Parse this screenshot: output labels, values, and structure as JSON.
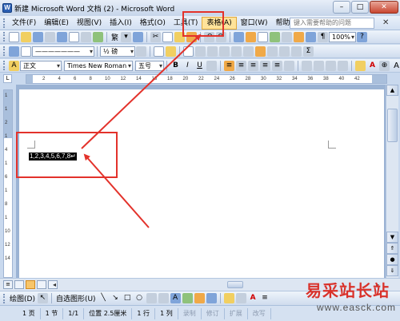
{
  "window": {
    "title": "新建 Microsoft Word 文档 (2) - Microsoft Word",
    "minimize": "–",
    "maximize": "□",
    "close": "✕"
  },
  "menubar": {
    "items": [
      {
        "label": "文件(F)"
      },
      {
        "label": "编辑(E)"
      },
      {
        "label": "视图(V)"
      },
      {
        "label": "插入(I)"
      },
      {
        "label": "格式(O)"
      },
      {
        "label": "工具(T)"
      },
      {
        "label": "表格(A)",
        "active": true
      },
      {
        "label": "窗口(W)"
      },
      {
        "label": "帮助(H)"
      }
    ],
    "help_placeholder": "键入需要帮助的问题",
    "doc_close": "✕"
  },
  "toolbar_standard": {
    "zoom": "100%",
    "script_label": "繁",
    "help_label": "?"
  },
  "toolbar_drawing_top": {
    "line_weight": "½ 磅",
    "line_style": "———————"
  },
  "toolbar_format": {
    "style": "正文",
    "font": "Times New Roman",
    "size": "五号",
    "bold": "B",
    "italic": "I",
    "underline": "U",
    "font_color_label": "A",
    "grow_font": "A",
    "shrink_font": "A"
  },
  "ruler": {
    "ticks": [
      "2",
      "4",
      "6",
      "8",
      "10",
      "12",
      "14",
      "16",
      "18",
      "20",
      "22",
      "24",
      "26",
      "28",
      "30",
      "32",
      "34",
      "36",
      "38",
      "40",
      "42"
    ],
    "vticks": [
      "1",
      "1",
      "2",
      "1",
      "4",
      "1",
      "6",
      "1",
      "8",
      "1",
      "10",
      "12",
      "14"
    ]
  },
  "document": {
    "selected_text": "1,2,3,4,5,6,7,8",
    "para_mark": "↵"
  },
  "drawbar": {
    "draw_label": "绘图(D)",
    "autoshapes_label": "自选图形(U)"
  },
  "statusbar": {
    "page": "1 页",
    "section": "1 节",
    "pages": "1/1",
    "position": "位置 2.5厘米",
    "line": "1 行",
    "column": "1 列",
    "rec": "录制",
    "trk": "修订",
    "ext": "扩展",
    "ovr": "改写"
  },
  "watermark": {
    "title": "易采站长站",
    "url": "www.easck.com"
  },
  "colors": {
    "annotation": "#e3322b",
    "selection": "#000000",
    "menu_highlight": "#ffe39a"
  }
}
